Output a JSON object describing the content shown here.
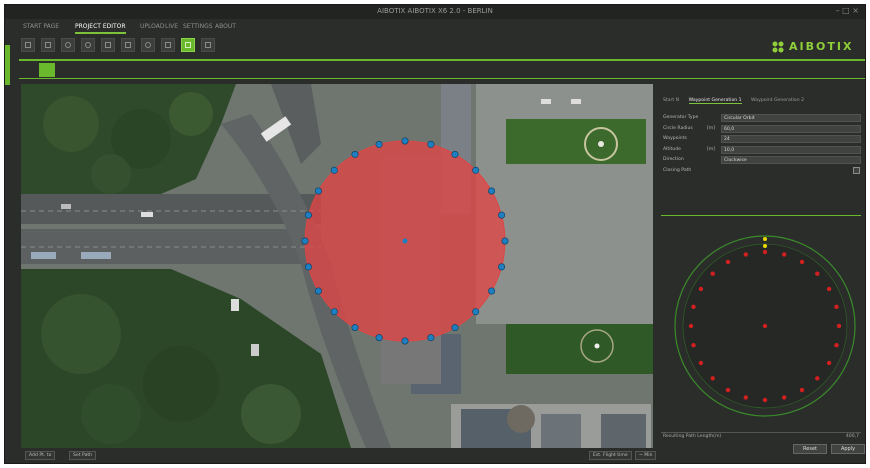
{
  "window": {
    "title": "AIBOTIX AIBOTIX X6 2.0 - BERLIN",
    "controls": "– □ ×"
  },
  "tabs": [
    {
      "label": "START PAGE",
      "active": false
    },
    {
      "label": "PROJECT EDITOR",
      "active": true
    },
    {
      "label": "UPLOAD",
      "active": false
    },
    {
      "label": "LIVE",
      "active": false
    },
    {
      "label": "SETTINGS",
      "active": false
    },
    {
      "label": "ABOUT",
      "active": false
    }
  ],
  "toolbar_icons": [
    "save-icon",
    "open-icon",
    "gear-icon",
    "gear-icon",
    "edit-icon",
    "copy-icon",
    "target-icon",
    "marker-icon",
    "grid-icon",
    "image-icon"
  ],
  "brand": {
    "name": "AIBOTIX",
    "accent": "#6ab82b"
  },
  "right_panel": {
    "tabs": [
      {
        "label": "Start N",
        "selected": false
      },
      {
        "label": "Waypoint Generation 1",
        "selected": true
      },
      {
        "label": "Waypoint Generation 2",
        "selected": false
      }
    ],
    "fields": [
      {
        "label": "Generator Type",
        "unit": "",
        "value": "Circular Orbit",
        "kind": "select"
      },
      {
        "label": "Circle Radius",
        "unit": "[m]",
        "value": "60,0",
        "kind": "spin"
      },
      {
        "label": "Waypoints",
        "unit": "",
        "value": "24",
        "kind": "spin"
      },
      {
        "label": "Altitude",
        "unit": "[m]",
        "value": "10,0",
        "kind": "spin"
      },
      {
        "label": "Direction",
        "unit": "",
        "value": "Clockwise",
        "kind": "select"
      },
      {
        "label": "Closing Path",
        "unit": "",
        "value": "",
        "kind": "check"
      }
    ],
    "footer_label": "Resulting Path Length(m)",
    "footer_value": "400,7",
    "buttons": {
      "reset": "Reset",
      "apply": "Apply"
    }
  },
  "statusbar": {
    "left1": "Add Pt. to",
    "left2": "Set Path",
    "right1": "Est. Flight time",
    "right2": "~ Min"
  },
  "colors": {
    "orbit_fill": "#e04545",
    "waypoint": "#1e7fc0",
    "radar_point": "#d22020",
    "radar_ring": "#3a8a2a",
    "home_marker": "#e8d800"
  }
}
